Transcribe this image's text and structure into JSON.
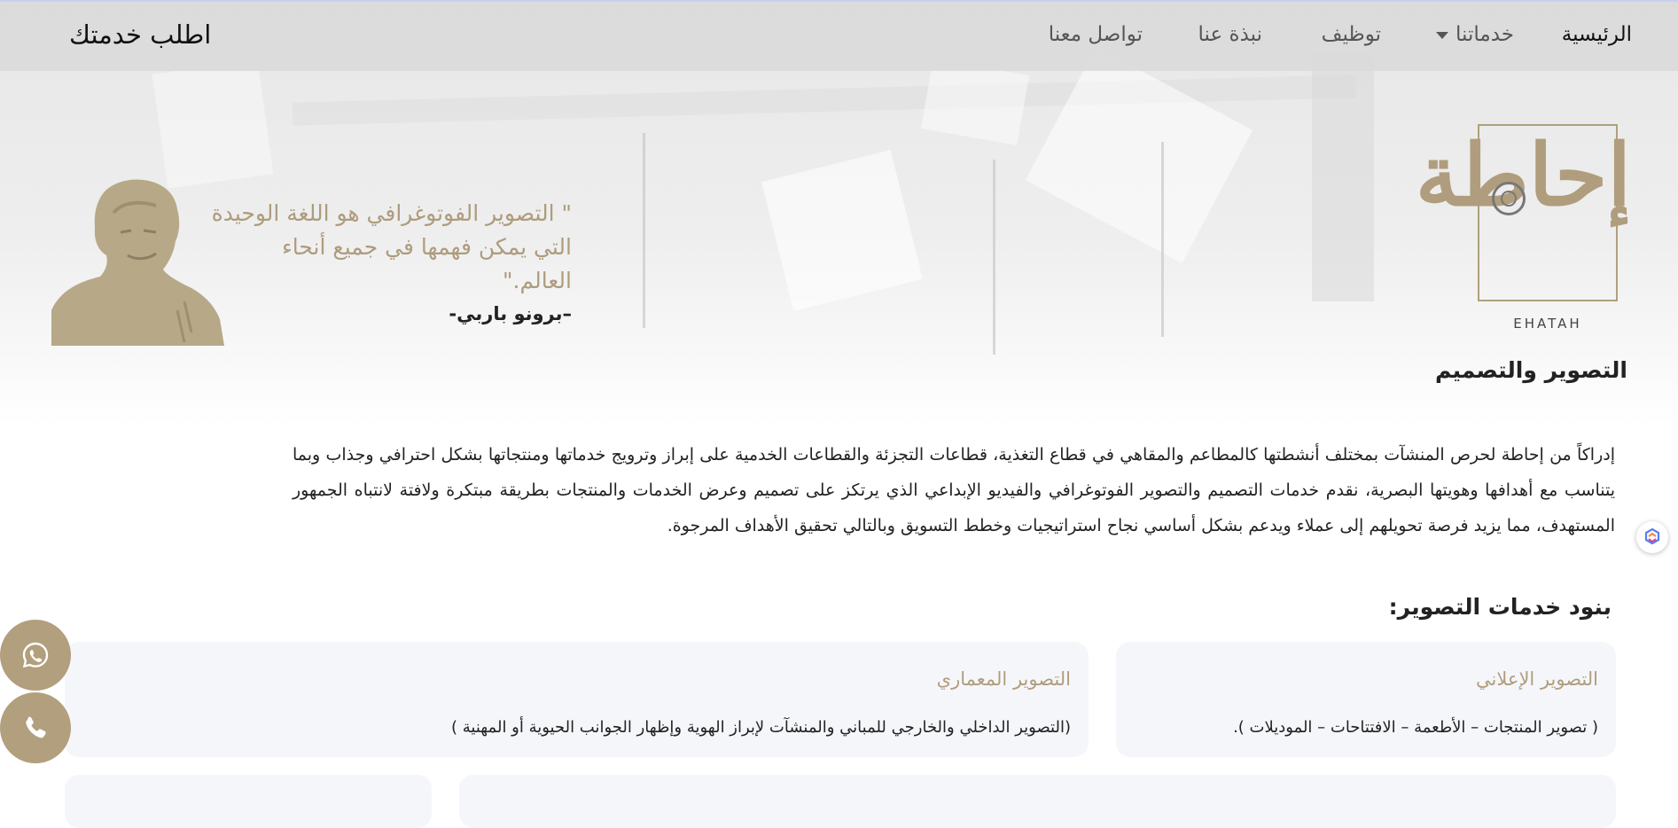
{
  "nav": {
    "items": [
      {
        "label": "الرئيسية",
        "active": true
      },
      {
        "label": "خدماتنا",
        "has_dropdown": true
      },
      {
        "label": "توظيف"
      },
      {
        "label": "نبذة عنا"
      },
      {
        "label": "تواصل معنا"
      }
    ],
    "cta": "اطلب خدمتك"
  },
  "logo": {
    "wordmark": "EHATAH",
    "glyph": "إحاطة"
  },
  "hero": {
    "section_title": "التصوير والتصميم",
    "quote": "\" التصوير الفوتوغرافي هو اللغة الوحيدة التي يمكن فهمها في جميع أنحاء العالم.\"",
    "quote_author": "–برونو باربي-"
  },
  "intro_text": "إدراكاً من إحاطة لحرص المنشآت بمختلف أنشطتها كالمطاعم والمقاهي في قطاع التغذية، قطاعات التجزئة والقطاعات الخدمية على إبراز وترويج خدماتها ومنتجاتها بشكل احترافي وجذاب وبما يتناسب مع أهدافها وهويتها البصرية، نقدم خدمات التصميم والتصوير الفوتوغرافي والفيديو الإبداعي الذي يرتكز على تصميم وعرض الخدمات والمنتجات بطريقة مبتكرة ولافتة لانتباه الجمهور المستهدف، مما يزيد فرصة تحويلهم إلى عملاء ويدعم بشكل أساسي نجاح استراتيجيات وخطط التسويق وبالتالي تحقيق الأهداف المرجوة.",
  "services": {
    "title": "بنود خدمات التصوير:",
    "cards": [
      {
        "title": "التصوير الإعلاني",
        "desc": "( تصوير المنتجات – الأطعمة – الافتتاحات – الموديلات )."
      },
      {
        "title": "التصوير المعماري",
        "desc": "(التصوير الداخلي والخارجي للمباني والمنشآت لإبراز الهوية وإظهار الجوانب الحيوية أو المهنية )"
      }
    ]
  },
  "floating": {
    "whatsapp_icon": "whatsapp-icon",
    "phone_icon": "phone-icon"
  },
  "colors": {
    "accent": "#b19f7d",
    "nav_bg": "#dadada",
    "card_bg": "#f5f6f9"
  }
}
